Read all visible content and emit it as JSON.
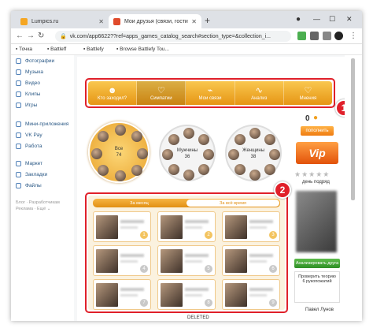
{
  "browser": {
    "tabs": [
      {
        "title": "Lumpics.ru",
        "fav_color": "#f5a623"
      },
      {
        "title": "Мои друзья (связи, гости)",
        "fav_color": "#e04b2b"
      }
    ],
    "url": "vk.com/app6622??ref=apps_games_catalog_search#section_type=&collection_i..."
  },
  "bookmarks": [
    "Точка",
    "Battleff",
    "Battlefy",
    "Browse Battlefy Tou..."
  ],
  "sidebar": {
    "items": [
      "Фотографии",
      "Музыка",
      "Видео",
      "Клипы",
      "Игры",
      "Мини-приложения",
      "VK Pay",
      "Работа",
      "Маркет",
      "Закладки",
      "Файлы"
    ],
    "footer": [
      "Блог · Разработчикам",
      "Реклама · Ещё ⌄"
    ]
  },
  "app": {
    "menu": [
      {
        "label": "Кто заходил?",
        "icon": "person-icon"
      },
      {
        "label": "Симпатии",
        "icon": "heart-icon"
      },
      {
        "label": "Мои связи",
        "icon": "link-icon"
      },
      {
        "label": "Анализ",
        "icon": "chart-icon"
      },
      {
        "label": "Мнения",
        "icon": "heart-icon"
      }
    ],
    "circles": [
      {
        "label": "Все",
        "count": "74"
      },
      {
        "label": "Мужчины",
        "count": "36"
      },
      {
        "label": "Женщины",
        "count": "38"
      }
    ],
    "coins": "0",
    "topup_label": "пополнить",
    "vip_label": "Vip",
    "day_rating": "день подряд",
    "analyze_label": "Анализировать друга",
    "promo": "Проверить теорию 6 рукопожатий",
    "friend_name": "Павел Лунов",
    "subtabs": [
      "За месяц",
      "За всё время"
    ],
    "cards": [
      "1",
      "2",
      "3",
      "4",
      "5",
      "6",
      "7",
      "8",
      "9"
    ],
    "deleted": "DELETED"
  },
  "markers": [
    "1",
    "2"
  ],
  "colors": {
    "accent": "#f0a020",
    "marker": "#e0202a",
    "vk_link": "#2a5885"
  }
}
